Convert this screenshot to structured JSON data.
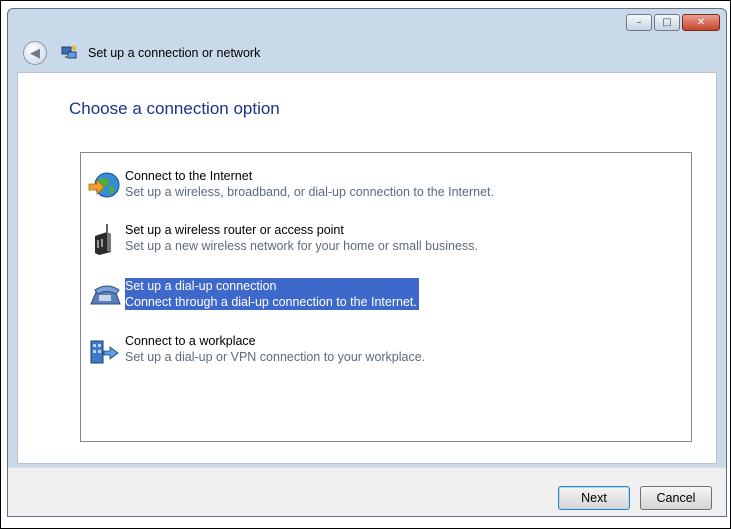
{
  "window": {
    "title": "Set up a connection or network",
    "controls": {
      "minimize": "–",
      "maximize": "□",
      "close": "✕"
    }
  },
  "page": {
    "heading": "Choose a connection option"
  },
  "options": [
    {
      "title": "Connect to the Internet",
      "description": "Set up a wireless, broadband, or dial-up connection to the Internet.",
      "icon": "globe-internet-icon",
      "selected": false
    },
    {
      "title": "Set up a wireless router or access point",
      "description": "Set up a new wireless network for your home or small business.",
      "icon": "wireless-router-icon",
      "selected": false
    },
    {
      "title": "Set up a dial-up connection",
      "description": "Connect through a dial-up connection to the Internet.",
      "icon": "telephone-modem-icon",
      "selected": true
    },
    {
      "title": "Connect to a workplace",
      "description": "Set up a dial-up or VPN connection to your workplace.",
      "icon": "workplace-vpn-icon",
      "selected": false
    }
  ],
  "buttons": {
    "next": "Next",
    "cancel": "Cancel"
  },
  "colors": {
    "selection": "#3e68c9",
    "heading": "#1e3287",
    "window_frame": "#c9d9ea"
  }
}
